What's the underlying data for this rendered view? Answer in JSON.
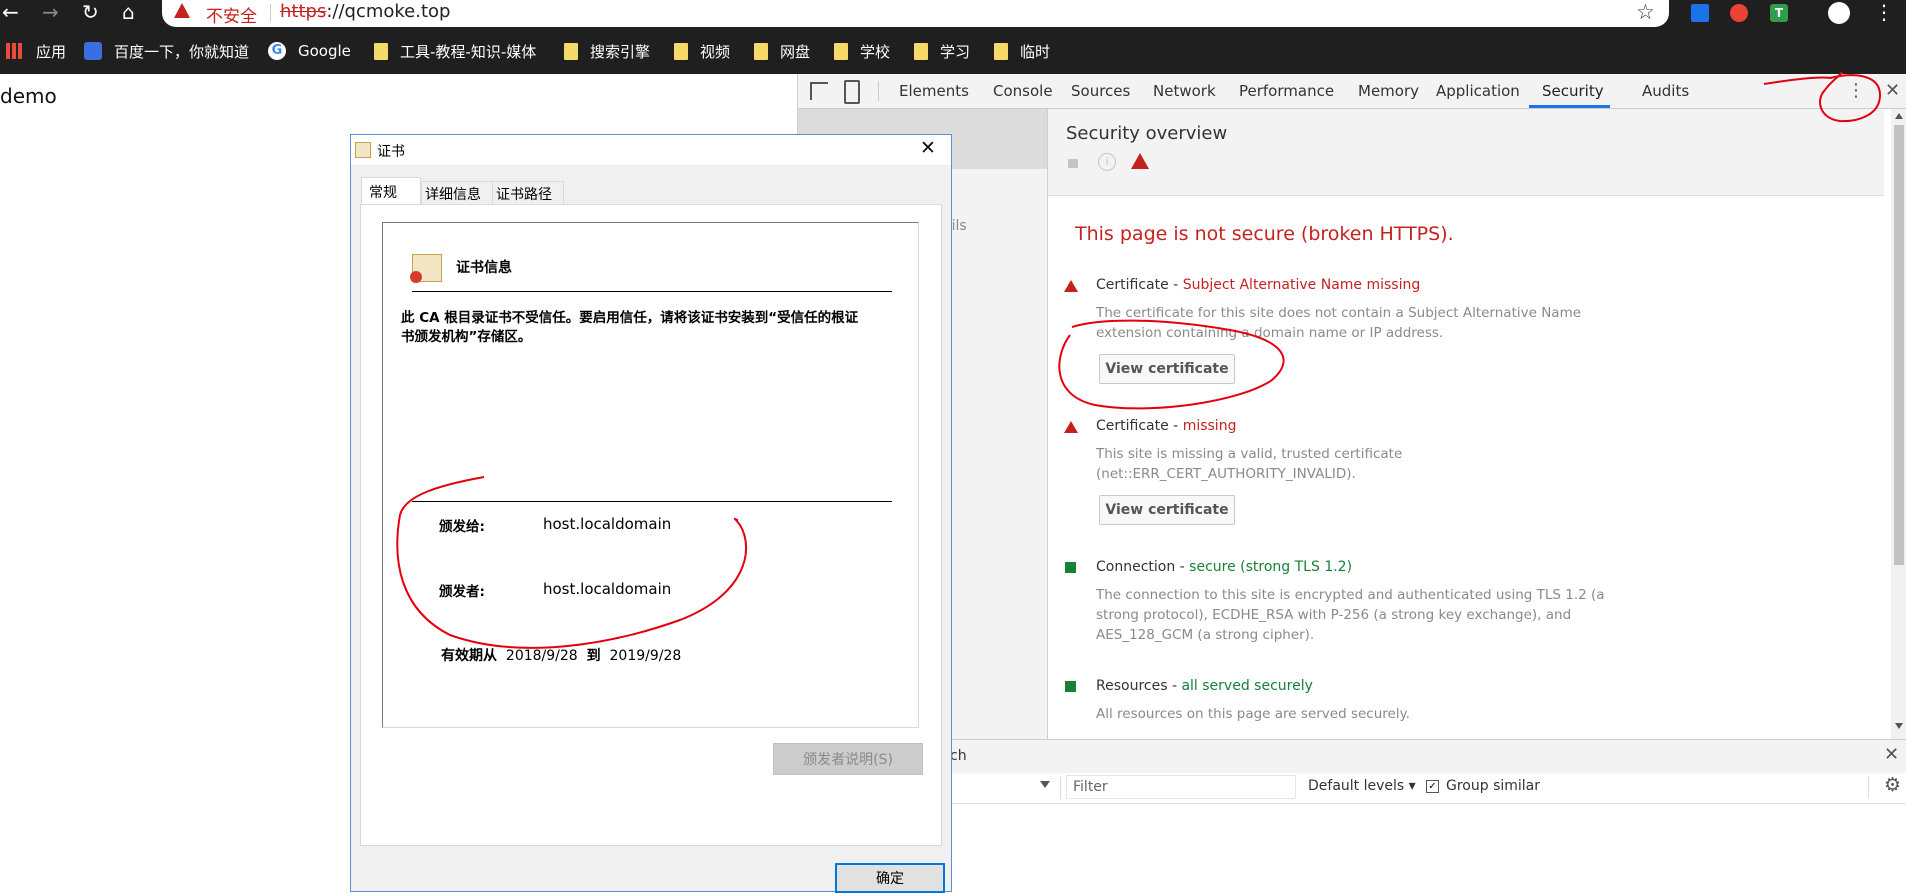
{
  "browser": {
    "url_security_label": "不安全",
    "url_scheme": "https",
    "url_rest": "://qcmoke.top",
    "bookmarks": [
      {
        "label": "应用",
        "icon": "apps-icon"
      },
      {
        "label": "百度一下，你就知道",
        "icon": "baidu-icon"
      },
      {
        "label": "Google",
        "icon": "google-icon"
      },
      {
        "label": "工具-教程-知识-媒体",
        "icon": "folder-icon"
      },
      {
        "label": "搜索引擎",
        "icon": "folder-icon"
      },
      {
        "label": "视频",
        "icon": "folder-icon"
      },
      {
        "label": "网盘",
        "icon": "folder-icon"
      },
      {
        "label": "学校",
        "icon": "folder-icon"
      },
      {
        "label": "学习",
        "icon": "folder-icon"
      },
      {
        "label": "临时",
        "icon": "folder-icon"
      }
    ]
  },
  "page": {
    "text": "demo"
  },
  "devtools": {
    "tabs": [
      "Elements",
      "Console",
      "Sources",
      "Network",
      "Performance",
      "Memory",
      "Application",
      "Security",
      "Audits"
    ],
    "active_tab": "Security",
    "sidebar_fragment": "ails",
    "overview_title": "Security overview",
    "page_status": "This page is not secure (broken HTTPS).",
    "items": [
      {
        "status": "bad",
        "name": "Certificate",
        "summary": "Subject Alternative Name missing",
        "description": "The certificate for this site does not contain a Subject Alternative Name extension containing a domain name or IP address.",
        "button": "View certificate"
      },
      {
        "status": "bad",
        "name": "Certificate",
        "summary": "missing",
        "description": "This site is missing a valid, trusted certificate (net::ERR_CERT_AUTHORITY_INVALID).",
        "button": "View certificate"
      },
      {
        "status": "good",
        "name": "Connection",
        "summary": "secure (strong TLS 1.2)",
        "description": "The connection to this site is encrypted and authenticated using TLS 1.2 (a strong protocol), ECDHE_RSA with P-256 (a strong key exchange), and AES_128_GCM (a strong cipher)."
      },
      {
        "status": "good",
        "name": "Resources",
        "summary": "all served securely",
        "description": "All resources on this page are served securely."
      }
    ],
    "console": {
      "drawer_fragment": "ch",
      "filter_placeholder": "Filter",
      "levels": "Default levels",
      "group_similar": "Group similar"
    }
  },
  "dialog": {
    "title": "证书",
    "tabs": [
      "常规",
      "详细信息",
      "证书路径"
    ],
    "info_heading": "证书信息",
    "message": "此 CA 根目录证书不受信任。要启用信任，请将该证书安装到“受信任的根证书颁发机构”存储区。",
    "issued_to_label": "颁发给:",
    "issued_to": "host.localdomain",
    "issued_by_label": "颁发者:",
    "issued_by": "host.localdomain",
    "validity_label": "有效期从",
    "valid_from": "2018/9/28",
    "valid_to_label": "到",
    "valid_to": "2019/9/28",
    "issuer_statement_button": "颁发者说明(S)",
    "ok_button": "确定"
  },
  "colors": {
    "danger": "#c5221f",
    "secure": "#188038",
    "annotation": "#e3000f",
    "tab_active": "#1a73e8"
  }
}
